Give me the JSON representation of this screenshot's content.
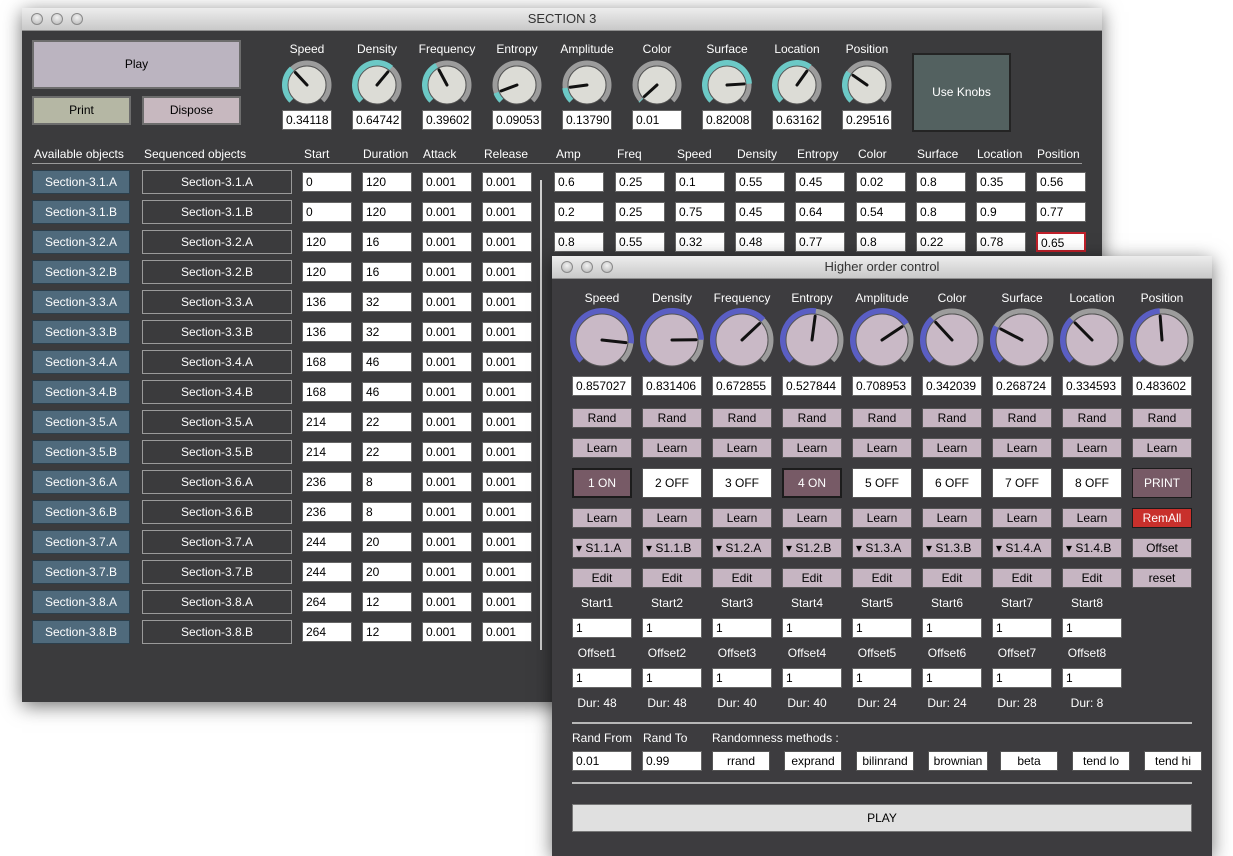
{
  "section": {
    "title": "SECTION 3",
    "play_label": "Play",
    "print_label": "Print",
    "dispose_label": "Dispose",
    "use_knobs_label": "Use Knobs",
    "knobs": [
      {
        "label": "Speed",
        "value": "0.34118",
        "level": 0.34118
      },
      {
        "label": "Density",
        "value": "0.64742",
        "level": 0.64742
      },
      {
        "label": "Frequency",
        "value": "0.39602",
        "level": 0.39602
      },
      {
        "label": "Entropy",
        "value": "0.09053",
        "level": 0.09053
      },
      {
        "label": "Amplitude",
        "value": "0.13790",
        "level": 0.1379
      },
      {
        "label": "Color",
        "value": "0.01",
        "level": 0.01
      },
      {
        "label": "Surface",
        "value": "0.82008",
        "level": 0.82008
      },
      {
        "label": "Location",
        "value": "0.63162",
        "level": 0.63162
      },
      {
        "label": "Position",
        "value": "0.29516",
        "level": 0.29516
      }
    ],
    "headers": [
      "Available objects",
      "Sequenced objects",
      "Start",
      "Duration",
      "Attack",
      "Release",
      "Amp",
      "Freq",
      "Speed",
      "Density",
      "Entropy",
      "Color",
      "Surface",
      "Location",
      "Position"
    ],
    "rows": [
      {
        "available": "Section-3.1.A",
        "sequenced": "Section-3.1.A",
        "start": "0",
        "duration": "120",
        "attack": "0.001",
        "release": "0.001",
        "params": [
          "0.6",
          "0.25",
          "0.1",
          "0.55",
          "0.45",
          "0.02",
          "0.8",
          "0.35",
          "0.56"
        ]
      },
      {
        "available": "Section-3.1.B",
        "sequenced": "Section-3.1.B",
        "start": "0",
        "duration": "120",
        "attack": "0.001",
        "release": "0.001",
        "params": [
          "0.2",
          "0.25",
          "0.75",
          "0.45",
          "0.64",
          "0.54",
          "0.8",
          "0.9",
          "0.77"
        ]
      },
      {
        "available": "Section-3.2.A",
        "sequenced": "Section-3.2.A",
        "start": "120",
        "duration": "16",
        "attack": "0.001",
        "release": "0.001",
        "params": [
          "0.8",
          "0.55",
          "0.32",
          "0.48",
          "0.77",
          "0.8",
          "0.22",
          "0.78",
          "0.65"
        ]
      },
      {
        "available": "Section-3.2.B",
        "sequenced": "Section-3.2.B",
        "start": "120",
        "duration": "16",
        "attack": "0.001",
        "release": "0.001"
      },
      {
        "available": "Section-3.3.A",
        "sequenced": "Section-3.3.A",
        "start": "136",
        "duration": "32",
        "attack": "0.001",
        "release": "0.001"
      },
      {
        "available": "Section-3.3.B",
        "sequenced": "Section-3.3.B",
        "start": "136",
        "duration": "32",
        "attack": "0.001",
        "release": "0.001"
      },
      {
        "available": "Section-3.4.A",
        "sequenced": "Section-3.4.A",
        "start": "168",
        "duration": "46",
        "attack": "0.001",
        "release": "0.001"
      },
      {
        "available": "Section-3.4.B",
        "sequenced": "Section-3.4.B",
        "start": "168",
        "duration": "46",
        "attack": "0.001",
        "release": "0.001"
      },
      {
        "available": "Section-3.5.A",
        "sequenced": "Section-3.5.A",
        "start": "214",
        "duration": "22",
        "attack": "0.001",
        "release": "0.001"
      },
      {
        "available": "Section-3.5.B",
        "sequenced": "Section-3.5.B",
        "start": "214",
        "duration": "22",
        "attack": "0.001",
        "release": "0.001"
      },
      {
        "available": "Section-3.6.A",
        "sequenced": "Section-3.6.A",
        "start": "236",
        "duration": "8",
        "attack": "0.001",
        "release": "0.001"
      },
      {
        "available": "Section-3.6.B",
        "sequenced": "Section-3.6.B",
        "start": "236",
        "duration": "8",
        "attack": "0.001",
        "release": "0.001"
      },
      {
        "available": "Section-3.7.A",
        "sequenced": "Section-3.7.A",
        "start": "244",
        "duration": "20",
        "attack": "0.001",
        "release": "0.001"
      },
      {
        "available": "Section-3.7.B",
        "sequenced": "Section-3.7.B",
        "start": "244",
        "duration": "20",
        "attack": "0.001",
        "release": "0.001"
      },
      {
        "available": "Section-3.8.A",
        "sequenced": "Section-3.8.A",
        "start": "264",
        "duration": "12",
        "attack": "0.001",
        "release": "0.001"
      },
      {
        "available": "Section-3.8.B",
        "sequenced": "Section-3.8.B",
        "start": "264",
        "duration": "12",
        "attack": "0.001",
        "release": "0.001"
      }
    ]
  },
  "hoc": {
    "title": "Higher order control",
    "knobs": [
      {
        "label": "Speed",
        "value": "0.857027",
        "level": 0.857027
      },
      {
        "label": "Density",
        "value": "0.831406",
        "level": 0.831406
      },
      {
        "label": "Frequency",
        "value": "0.672855",
        "level": 0.672855
      },
      {
        "label": "Entropy",
        "value": "0.527844",
        "level": 0.527844
      },
      {
        "label": "Amplitude",
        "value": "0.708953",
        "level": 0.708953
      },
      {
        "label": "Color",
        "value": "0.342039",
        "level": 0.342039
      },
      {
        "label": "Surface",
        "value": "0.268724",
        "level": 0.268724
      },
      {
        "label": "Location",
        "value": "0.334593",
        "level": 0.334593
      },
      {
        "label": "Position",
        "value": "0.483602",
        "level": 0.483602
      }
    ],
    "rand_label": "Rand",
    "learn_label": "Learn",
    "toggles": [
      {
        "label": "1 ON",
        "on": true
      },
      {
        "label": "2 OFF",
        "on": false
      },
      {
        "label": "3 OFF",
        "on": false
      },
      {
        "label": "4 ON",
        "on": true
      },
      {
        "label": "5 OFF",
        "on": false
      },
      {
        "label": "6 OFF",
        "on": false
      },
      {
        "label": "7 OFF",
        "on": false
      },
      {
        "label": "8 OFF",
        "on": false
      }
    ],
    "print_label": "PRINT",
    "remall_label": "RemAll",
    "offset_label": "Offset",
    "reset_label": "reset",
    "edit_label": "Edit",
    "menus": [
      "▾ S1.1.A",
      "▾ S1.1.B",
      "▾ S1.2.A",
      "▾ S1.2.B",
      "▾ S1.3.A",
      "▾ S1.3.B",
      "▾ S1.4.A",
      "▾ S1.4.B"
    ],
    "slots": [
      {
        "start_label": "Start1",
        "start_value": "1",
        "offset_label": "Offset1",
        "offset_value": "1",
        "dur": "Dur: 48"
      },
      {
        "start_label": "Start2",
        "start_value": "1",
        "offset_label": "Offset2",
        "offset_value": "1",
        "dur": "Dur: 48"
      },
      {
        "start_label": "Start3",
        "start_value": "1",
        "offset_label": "Offset3",
        "offset_value": "1",
        "dur": "Dur: 40"
      },
      {
        "start_label": "Start4",
        "start_value": "1",
        "offset_label": "Offset4",
        "offset_value": "1",
        "dur": "Dur: 40"
      },
      {
        "start_label": "Start5",
        "start_value": "1",
        "offset_label": "Offset5",
        "offset_value": "1",
        "dur": "Dur: 24"
      },
      {
        "start_label": "Start6",
        "start_value": "1",
        "offset_label": "Offset6",
        "offset_value": "1",
        "dur": "Dur: 24"
      },
      {
        "start_label": "Start7",
        "start_value": "1",
        "offset_label": "Offset7",
        "offset_value": "1",
        "dur": "Dur: 28"
      },
      {
        "start_label": "Start8",
        "start_value": "1",
        "offset_label": "Offset8",
        "offset_value": "1",
        "dur": "Dur: 8"
      }
    ],
    "rand_from_label": "Rand From",
    "rand_to_label": "Rand To",
    "rand_from_value": "0.01",
    "rand_to_value": "0.99",
    "randomness_label": "Randomness methods :",
    "methods": [
      "rrand",
      "exprand",
      "bilinrand",
      "brownian",
      "beta",
      "tend lo",
      "tend hi"
    ],
    "play_label": "PLAY"
  },
  "colors": {
    "panel_bg": "#3b3b3d",
    "knob_arc_cyan": "#6cc9c6",
    "knob_arc_blue": "#5a5ec4",
    "object_button": "#4f6a7c",
    "toggle_on": "#775a66",
    "remall_red": "#c8302c"
  }
}
